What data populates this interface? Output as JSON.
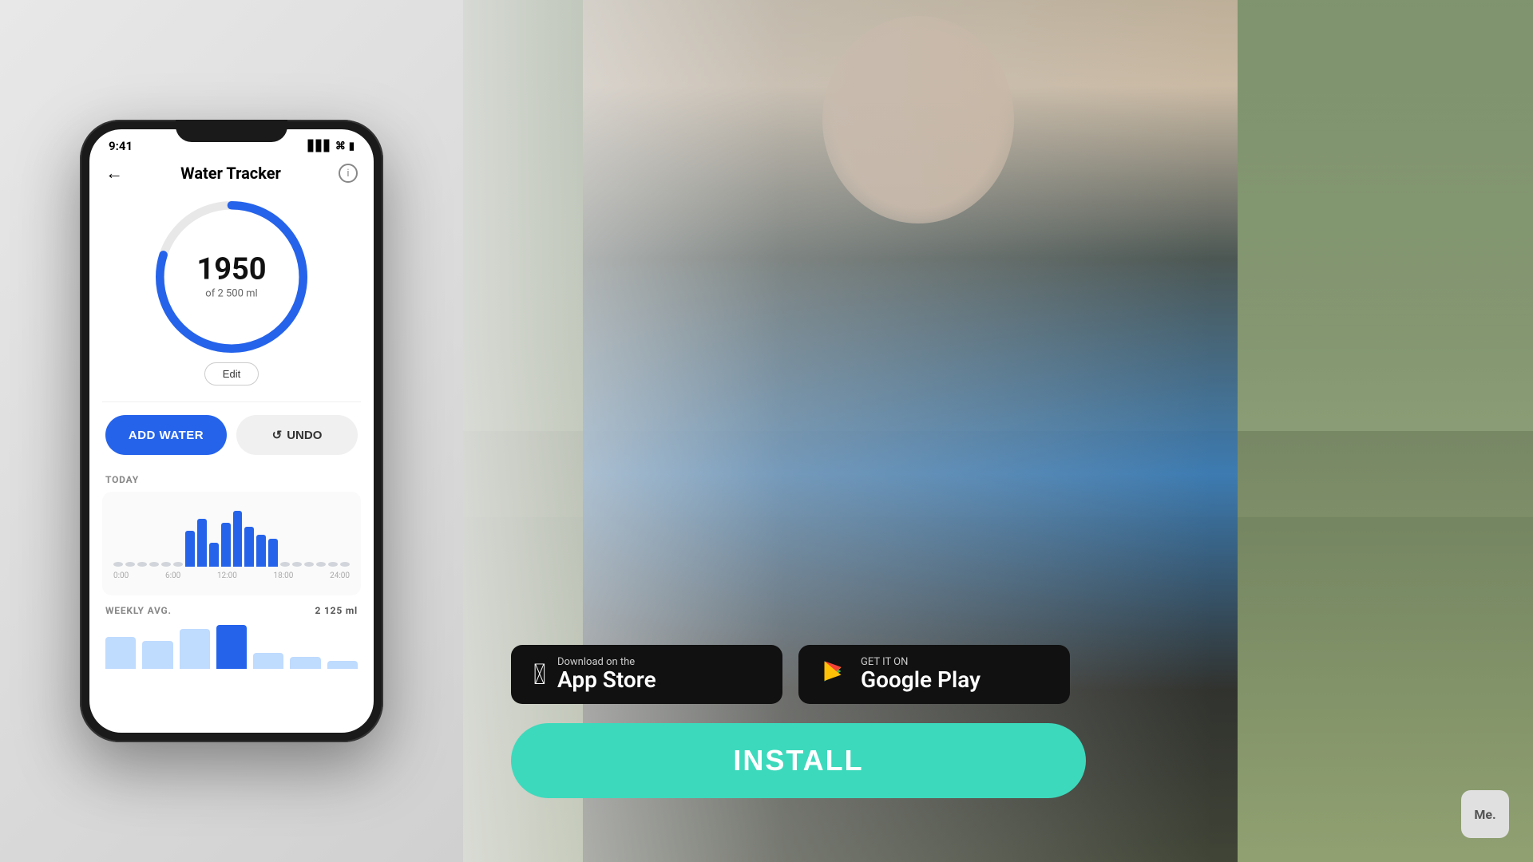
{
  "phone": {
    "status_time": "9:41",
    "status_icons": "▋▋▋ ☁ 🔋",
    "screen_title": "Water Tracker",
    "water_value": "1950",
    "water_sub": "of 2 500 ml",
    "edit_label": "Edit",
    "add_water_label": "ADD WATER",
    "undo_label": "UNDO",
    "today_label": "TODAY",
    "weekly_label": "WEEKLY AVG.",
    "weekly_value": "2 125 ml",
    "chart_labels": [
      "0:00",
      "6:00",
      "12:00",
      "18:00",
      "24:00"
    ]
  },
  "cta": {
    "app_store_small": "Download on the",
    "app_store_large": "App Store",
    "google_play_small": "GET IT ON",
    "google_play_large": "Google Play",
    "install_label": "INSTALL"
  },
  "me_badge": "Me.",
  "colors": {
    "blue": "#2563eb",
    "teal": "#3dd9bc",
    "dark": "#111111"
  }
}
